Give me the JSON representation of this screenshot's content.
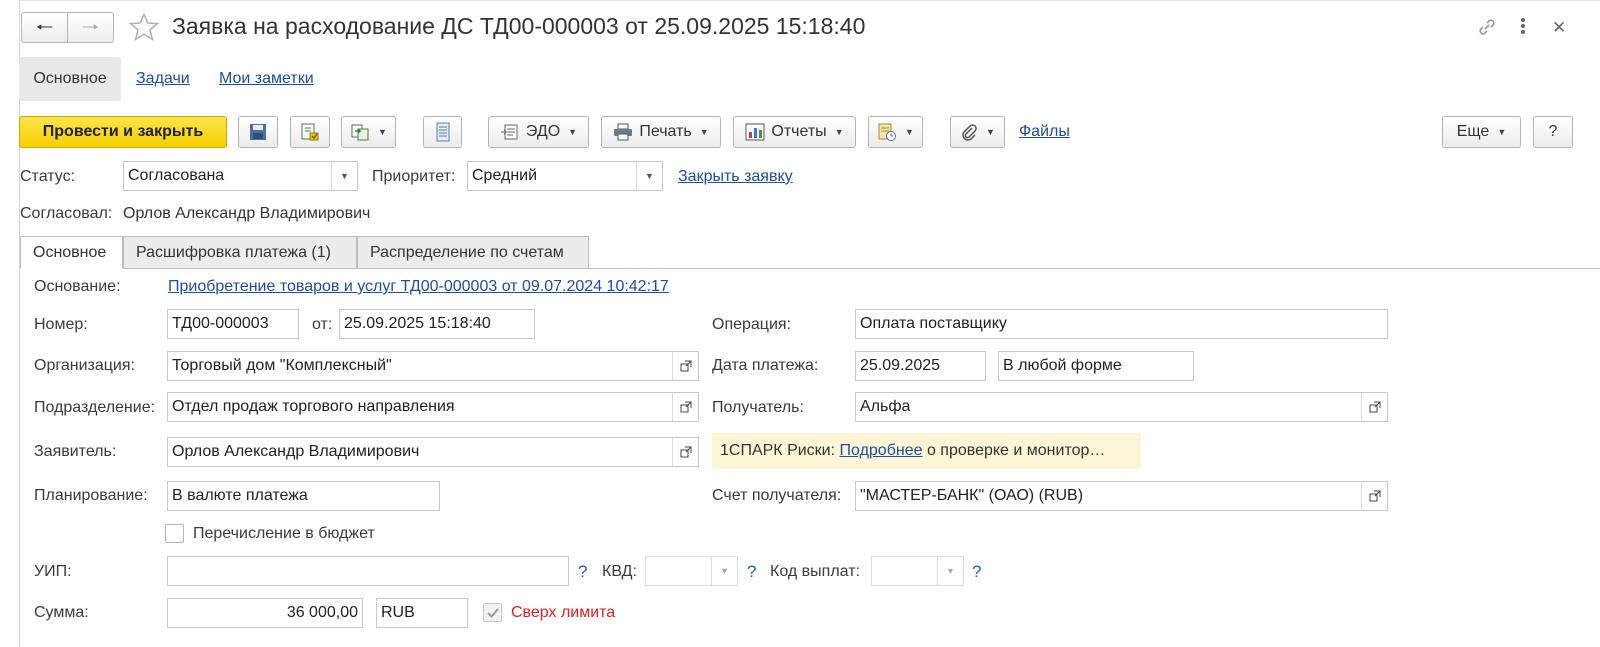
{
  "window": {
    "title": "Заявка на расходование ДС ТД00-000003 от 25.09.2025 15:18:40"
  },
  "nav": {
    "tabs": [
      "Основное",
      "Задачи",
      "Мои заметки"
    ]
  },
  "toolbar": {
    "post_close": "Провести и закрыть",
    "edo": "ЭДО",
    "print": "Печать",
    "reports": "Отчеты",
    "files": "Файлы",
    "more": "Еще",
    "help": "?"
  },
  "header": {
    "status_label": "Статус:",
    "status_value": "Согласована",
    "priority_label": "Приоритет:",
    "priority_value": "Средний",
    "close_request": "Закрыть заявку",
    "approved_label": "Согласовал:",
    "approved_value": "Орлов Александр Владимирович"
  },
  "tabs": [
    "Основное",
    "Расшифровка платежа (1)",
    "Распределение по счетам"
  ],
  "form": {
    "basis_label": "Основание:",
    "basis_value": "Приобретение товаров и услуг ТД00-000003 от 09.07.2024 10:42:17",
    "number_label": "Номер:",
    "number_value": "ТД00-000003",
    "from_label": "от:",
    "from_value": "25.09.2025 15:18:40",
    "org_label": "Организация:",
    "org_value": "Торговый дом \"Комплексный\"",
    "division_label": "Подразделение:",
    "division_value": "Отдел продаж торгового направления",
    "applicant_label": "Заявитель:",
    "applicant_value": "Орлов Александр Владимирович",
    "planning_label": "Планирование:",
    "planning_value": "В валюте платежа",
    "budget_label": "Перечисление в бюджет",
    "budget_checked": false,
    "uip_label": "УИП:",
    "uip_value": "",
    "kvd_label": "КВД:",
    "kvd_value": "",
    "payout_label": "Код выплат:",
    "payout_value": "",
    "help_mark": "?",
    "sum_label": "Сумма:",
    "sum_value": "36 000,00",
    "currency_value": "RUB",
    "over_limit_label": "Сверх лимита",
    "over_limit_checked": true,
    "operation_label": "Операция:",
    "operation_value": "Оплата поставщику",
    "paydate_label": "Дата платежа:",
    "paydate_value": "25.09.2025",
    "payform_value": "В любой форме",
    "recipient_label": "Получатель:",
    "recipient_value": "Альфа",
    "spark_prefix": "1СПАРК Риски:",
    "spark_link": "Подробнее",
    "spark_suffix": "о проверке и монитор…",
    "account_label": "Счет получателя:",
    "account_value": "\"МАСТЕР-БАНК\" (ОАО) (RUB)"
  },
  "colors": {
    "accent_yellow": "#f5cf00",
    "link": "#1d4ea5",
    "warning_red": "#e02020",
    "spark_bg": "#fdf6d6"
  }
}
